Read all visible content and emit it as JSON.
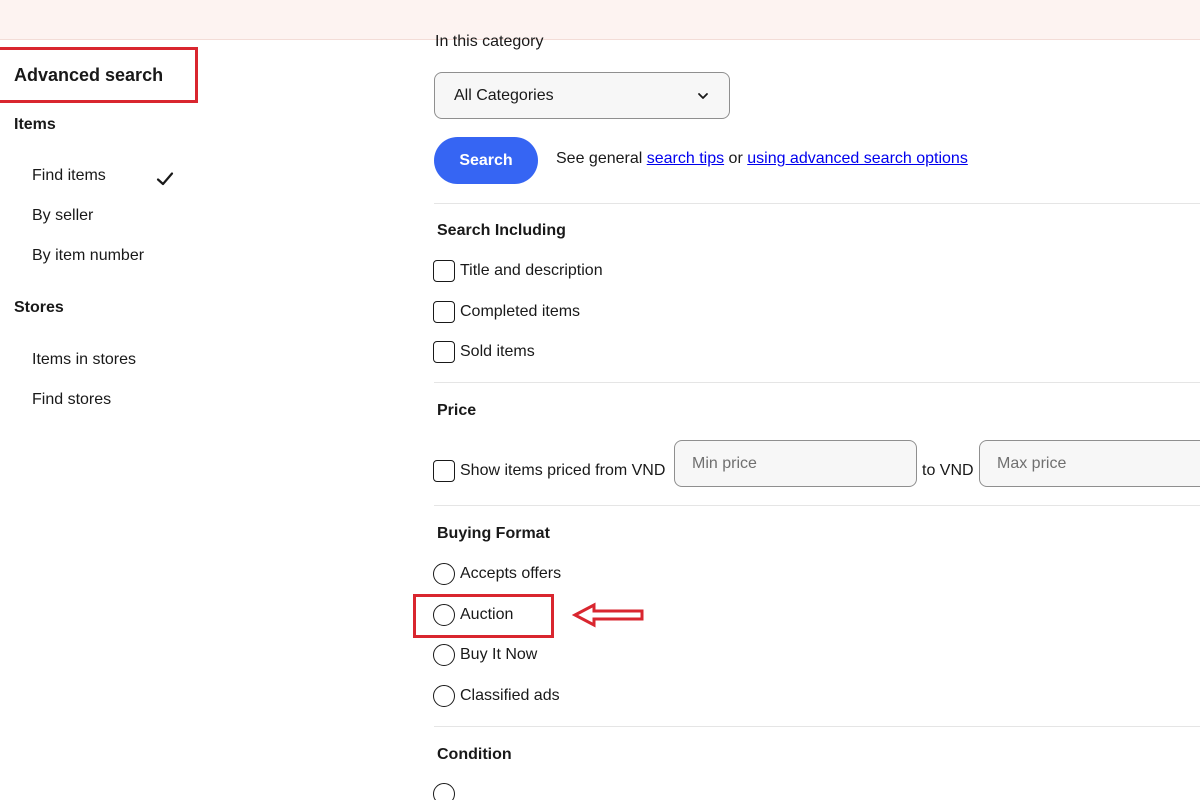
{
  "sidebar": {
    "title": "Advanced search",
    "sections": [
      {
        "label": "Items",
        "items": [
          {
            "label": "Find items",
            "selected": true
          },
          {
            "label": "By seller"
          },
          {
            "label": "By item number"
          }
        ]
      },
      {
        "label": "Stores",
        "items": [
          {
            "label": "Items in stores"
          },
          {
            "label": "Find stores"
          }
        ]
      }
    ]
  },
  "main": {
    "category_label": "In this category",
    "category_select": {
      "value": "All Categories",
      "icon": "chevron-down-icon"
    },
    "search_button": "Search",
    "tips": {
      "prefix": "See general ",
      "link1": "search tips",
      "middle": " or ",
      "link2": "using advanced search options"
    },
    "search_including": {
      "heading": "Search Including",
      "options": [
        "Title and description",
        "Completed items",
        "Sold items"
      ]
    },
    "price": {
      "heading": "Price",
      "checkbox_label": "Show items priced from VND",
      "min_placeholder": "Min price",
      "to_label": "to VND",
      "max_placeholder": "Max price"
    },
    "buying_format": {
      "heading": "Buying Format",
      "options": [
        "Accepts offers",
        "Auction",
        "Buy It Now",
        "Classified ads"
      ]
    },
    "condition": {
      "heading": "Condition"
    }
  },
  "annotations": {
    "color": "#d9262f",
    "arrow_icon": "left-arrow-icon"
  },
  "colors": {
    "accent": "#3665f3",
    "link": "#0000ee",
    "banner": "#fdf3f1"
  }
}
